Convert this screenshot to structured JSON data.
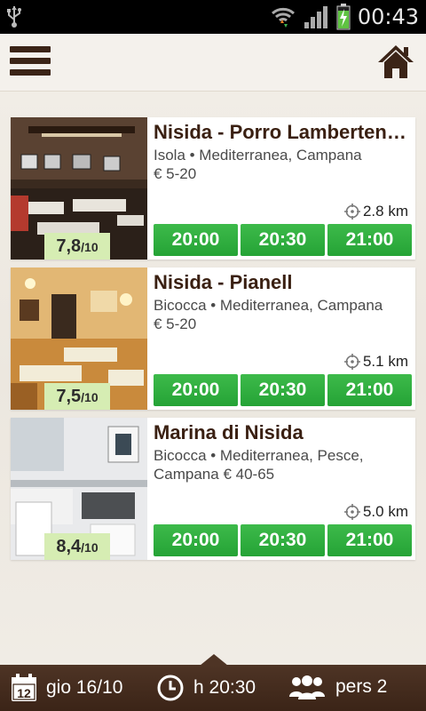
{
  "status": {
    "time": "00:43"
  },
  "header": {
    "menu_icon": "hamburger-menu-icon",
    "home_icon": "home-icon"
  },
  "restaurants": [
    {
      "name": "Nisida - Porro Lamberten…",
      "meta": "Isola • Mediterranea, Campana",
      "price": "€ 5-20",
      "rating": "7,8",
      "rating_max": "/10",
      "distance": "2.8 km",
      "slots": [
        "20:00",
        "20:30",
        "21:00"
      ]
    },
    {
      "name": "Nisida - Pianell",
      "meta": "Bicocca • Mediterranea, Campana",
      "price": "€ 5-20",
      "rating": "7,5",
      "rating_max": "/10",
      "distance": "5.1 km",
      "slots": [
        "20:00",
        "20:30",
        "21:00"
      ]
    },
    {
      "name": "Marina di Nisida",
      "meta": "Bicocca • Mediterranea, Pesce, Campana",
      "price": "€ 40-65",
      "rating": "8,4",
      "rating_max": "/10",
      "distance": "5.0 km",
      "slots": [
        "20:00",
        "20:30",
        "21:00"
      ]
    }
  ],
  "bottom": {
    "calendar_day": "12",
    "date": "gio 16/10",
    "time": "h 20:30",
    "people": "pers 2"
  },
  "colors": {
    "brand": "#3b2417",
    "slot_green": "#2bab3b",
    "rating_bg": "#d6edb3"
  }
}
